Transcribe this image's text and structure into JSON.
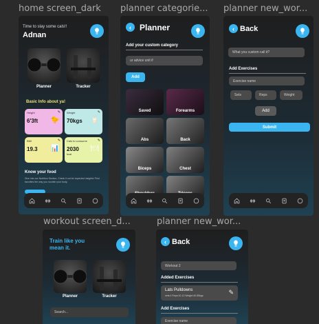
{
  "labels": {
    "home": "home screen_dark",
    "categories": "planner categorie...",
    "new1": "planner new_wor...",
    "workout": "workout screen_d...",
    "new2": "planner new_wor..."
  },
  "home": {
    "greeting": "Time to slay some cals!!",
    "name": "Adnan",
    "card1": "Planner",
    "card2": "Tracker",
    "basic_title": "Basic Info about ya!",
    "height_label": "Height",
    "height_value": "6'3ft",
    "weight_label": "Weight",
    "weight_value": "70kgs",
    "bmi_label": "BMI",
    "bmi_value": "19.3",
    "cals_label": "Cals to consume",
    "cals_value": "2030",
    "cals_unit": "kcal",
    "know_title": "Know your food",
    "know_text": "Dive into our Nutrition Section, Check it out for expected insights! Find favorites the way you nourish your body."
  },
  "planner": {
    "title": "Planner",
    "subtitle": "Add your custom category",
    "input_placeholder": "ur advice unit if",
    "add": "Add",
    "tiles": [
      "Saved",
      "Forearms",
      "Abs",
      "Back",
      "Biceps",
      "Chest",
      "Shoulders",
      "Triceps"
    ]
  },
  "new1": {
    "back": "Back",
    "input_placeholder": "What you custom call it?",
    "add_exercises": "Add Exercises",
    "exercise_name": "Exercise name",
    "sets": "Sets",
    "reps": "Reps",
    "weight": "Weight",
    "add": "Add",
    "submit": "Submit"
  },
  "workout": {
    "title_line1": "Train like you",
    "title_line2": "mean it.",
    "card1": "Planner",
    "card2": "Tracker",
    "search_placeholder": "Search..."
  },
  "new2": {
    "back": "Back",
    "workout_name": "Workout 2",
    "added_title": "Added Exercises",
    "exercise_name": "Lats Pulldowns",
    "exercise_detail": "sets:4   Reps:10-12  Weight:40-55kgs",
    "add_exercises": "Add Exercises",
    "exercise_placeholder": "Exercise name"
  },
  "colors": {
    "accent": "#3bb5f0",
    "height_card": "#f1b7e6",
    "weight_card": "#bfe9e6",
    "bmi_card": "#f0ee9c",
    "cals_card": "#e6f3a8"
  },
  "nav_icons": [
    "home-icon",
    "dumbbell-icon",
    "search-icon",
    "notes-icon",
    "profile-icon"
  ]
}
